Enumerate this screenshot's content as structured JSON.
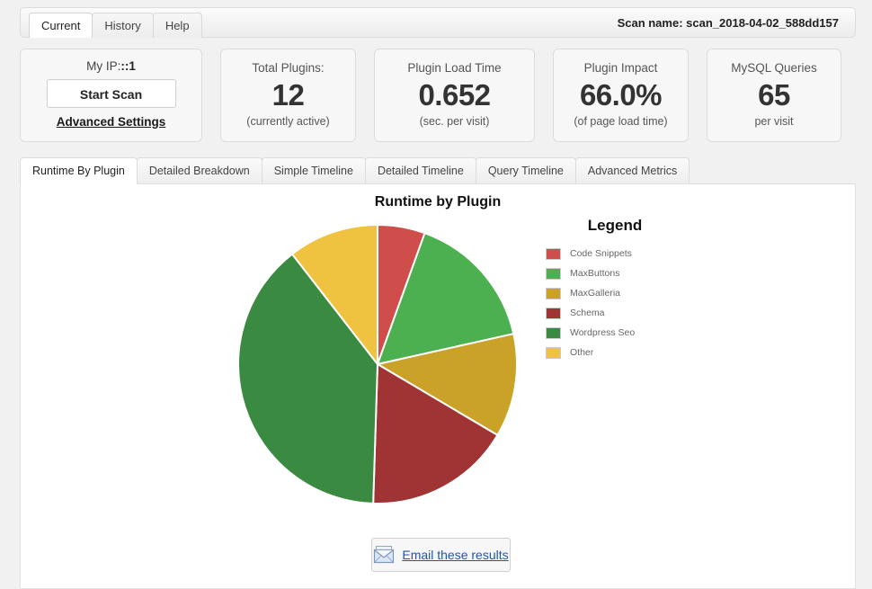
{
  "topbar": {
    "tabs": [
      {
        "label": "Current",
        "active": true
      },
      {
        "label": "History",
        "active": false
      },
      {
        "label": "Help",
        "active": false
      }
    ],
    "scan_name": "Scan name: scan_2018-04-02_588dd157"
  },
  "cards": {
    "ip": {
      "label_prefix": "My IP:",
      "label_value": "::1",
      "start_scan_label": "Start Scan",
      "advanced_settings_label": "Advanced Settings"
    },
    "total_plugins": {
      "label": "Total Plugins:",
      "value": "12",
      "sub": "(currently active)"
    },
    "plugin_load_time": {
      "label": "Plugin Load Time",
      "value": "0.652",
      "sub": "(sec. per visit)"
    },
    "plugin_impact": {
      "label": "Plugin Impact",
      "value": "66.0%",
      "sub": "(of page load time)"
    },
    "mysql_queries": {
      "label": "MySQL Queries",
      "value": "65",
      "sub": "per visit"
    }
  },
  "inner_tabs": [
    {
      "label": "Runtime By Plugin",
      "active": true
    },
    {
      "label": "Detailed Breakdown",
      "active": false
    },
    {
      "label": "Simple Timeline",
      "active": false
    },
    {
      "label": "Detailed Timeline",
      "active": false
    },
    {
      "label": "Query Timeline",
      "active": false
    },
    {
      "label": "Advanced Metrics",
      "active": false
    }
  ],
  "legend": {
    "title": "Legend"
  },
  "footer": {
    "email_label": "Email these results",
    "email_icon": "envelope-icon"
  },
  "chart_data": {
    "type": "pie",
    "title": "Runtime by Plugin",
    "legend_position": "right",
    "categories": [
      "Code Snippets",
      "MaxButtons",
      "MaxGalleria",
      "Schema",
      "Wordpress Seo",
      "Other"
    ],
    "values": [
      5.5,
      16.0,
      12.0,
      17.0,
      39.0,
      10.5
    ],
    "colors": [
      "#cf4d4a",
      "#4caf50",
      "#c9a227",
      "#a03333",
      "#3a8a42",
      "#efc33f"
    ],
    "start_angle": 0,
    "direction": "clockwise",
    "slice_border_color": "#ffffff"
  }
}
